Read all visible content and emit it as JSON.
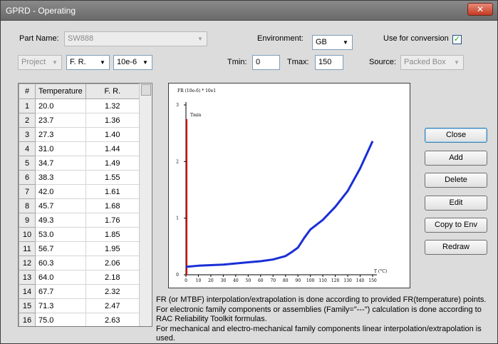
{
  "window": {
    "title": "GPRD - Operating",
    "close_glyph": "✕"
  },
  "form": {
    "part_name_label": "Part Name:",
    "part_name_value": "SW888",
    "environment_label": "Environment:",
    "environment_value": "GB",
    "use_for_conversion_label": "Use for conversion",
    "use_for_conversion_checked": true,
    "project_value": "Project",
    "fr_type_value": "F. R.",
    "fr_unit_value": "10e-6",
    "tmin_label": "Tmin:",
    "tmin_value": "0",
    "tmax_label": "Tmax:",
    "tmax_value": "150",
    "source_label": "Source:",
    "source_value": "Packed Box"
  },
  "table": {
    "headers": [
      "#",
      "Temperature",
      "F. R."
    ],
    "rows": [
      [
        "1",
        "20.0",
        "1.32"
      ],
      [
        "2",
        "23.7",
        "1.36"
      ],
      [
        "3",
        "27.3",
        "1.40"
      ],
      [
        "4",
        "31.0",
        "1.44"
      ],
      [
        "5",
        "34.7",
        "1.49"
      ],
      [
        "6",
        "38.3",
        "1.55"
      ],
      [
        "7",
        "42.0",
        "1.61"
      ],
      [
        "8",
        "45.7",
        "1.68"
      ],
      [
        "9",
        "49.3",
        "1.76"
      ],
      [
        "10",
        "53.0",
        "1.85"
      ],
      [
        "11",
        "56.7",
        "1.95"
      ],
      [
        "12",
        "60.3",
        "2.06"
      ],
      [
        "13",
        "64.0",
        "2.18"
      ],
      [
        "14",
        "67.7",
        "2.32"
      ],
      [
        "15",
        "71.3",
        "2.47"
      ],
      [
        "16",
        "75.0",
        "2.63"
      ]
    ]
  },
  "buttons": {
    "close": "Close",
    "add": "Add",
    "delete": "Delete",
    "edit": "Edit",
    "copy_to_env": "Copy to Env",
    "redraw": "Redraw"
  },
  "note_lines": [
    "FR (or MTBF) interpolation/extrapolation is done according to provided FR(temperature) points.",
    "For electronic family components or assemblies (Family=\"---\")  calculation is done according to RAC Reliability Toolkit formulas.",
    "For mechanical and electro-mechanical family components linear interpolation/extrapolation is used."
  ],
  "chart_data": {
    "type": "line",
    "ylabel": "FR (10e-6) * 10e1",
    "xlabel": "T (°C)",
    "xlim": [
      0,
      150
    ],
    "ylim": [
      0,
      3
    ],
    "x_ticks": [
      0,
      10,
      20,
      30,
      40,
      50,
      60,
      70,
      80,
      90,
      100,
      110,
      120,
      130,
      140,
      150
    ],
    "y_ticks": [
      0,
      1,
      2,
      3
    ],
    "tmin_marker": {
      "label": "Tmin",
      "x": 0,
      "color": "#cc0000"
    },
    "series": [
      {
        "color": "#1a2fd6",
        "x": [
          0,
          10,
          20,
          30,
          40,
          50,
          60,
          70,
          80,
          85,
          90,
          95,
          100,
          110,
          120,
          130,
          140,
          150
        ],
        "y": [
          0.14,
          0.16,
          0.17,
          0.18,
          0.2,
          0.22,
          0.24,
          0.27,
          0.33,
          0.4,
          0.48,
          0.65,
          0.8,
          0.97,
          1.2,
          1.48,
          1.88,
          2.36
        ]
      }
    ]
  }
}
